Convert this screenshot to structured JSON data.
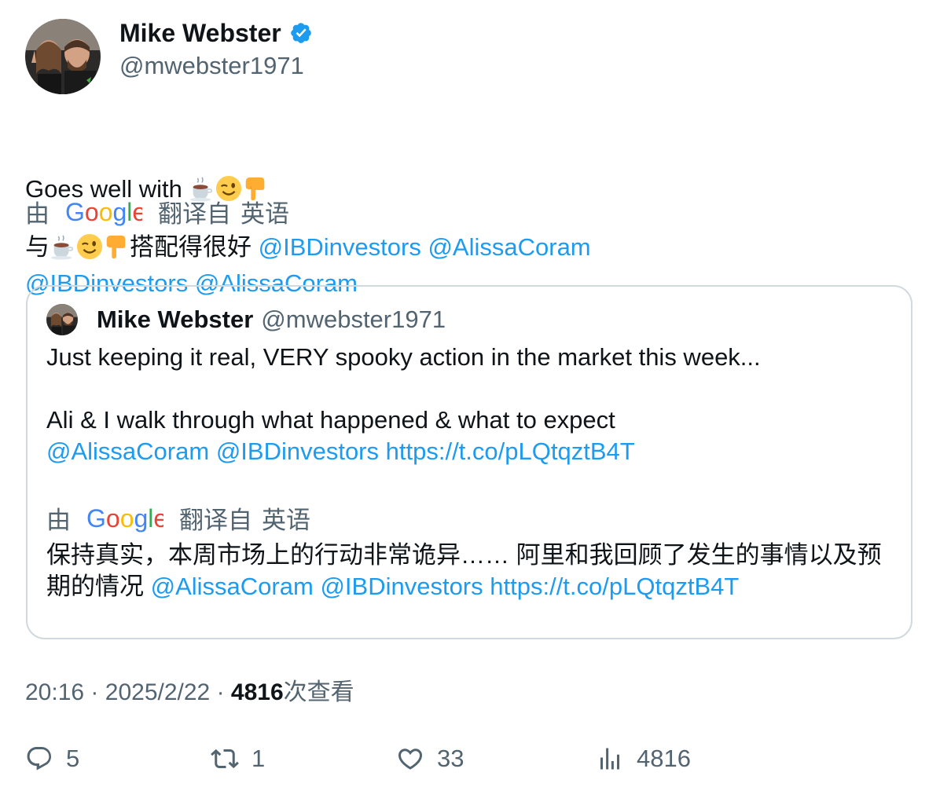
{
  "author": {
    "name": "Mike Webster",
    "handle": "@mwebster1971",
    "verified": true
  },
  "tweet": {
    "text_prefix": "Goes well with ",
    "emojis": [
      "coffee-emoji",
      "wink-emoji",
      "pointing-down-emoji"
    ],
    "mentions": [
      "@IBDinvestors",
      "@AlissaCoram"
    ]
  },
  "translation": {
    "by_label": "由",
    "provider": "Google",
    "from_label": "翻译自",
    "language": "英语",
    "text_prefix": "与",
    "text_suffix": "搭配得很好",
    "mentions": [
      "@IBDinvestors",
      "@AlissaCoram"
    ]
  },
  "quote": {
    "name": "Mike Webster",
    "handle": "@mwebster1971",
    "line1": "Just keeping it real, VERY spooky action in the market this week...",
    "line2": "Ali & I walk through what happened & what to expect",
    "mentions": [
      "@AlissaCoram",
      "@IBDinvestors"
    ],
    "link": "https://t.co/pLQtqztB4T",
    "translation": {
      "by_label": "由",
      "provider": "Google",
      "from_label": "翻译自",
      "language": "英语",
      "text": "保持真实，本周市场上的行动非常诡异…… 阿里和我回顾了发生的事情以及预期的情况",
      "mentions": [
        "@AlissaCoram",
        "@IBDinvestors"
      ],
      "link": "https://t.co/pLQtqztB4T"
    }
  },
  "meta": {
    "time": "20:16",
    "separator": "·",
    "date": "2025/2/22",
    "views_count": "4816",
    "views_label": "次查看"
  },
  "actions": {
    "replies": "5",
    "reposts": "1",
    "likes": "33",
    "views": "4816"
  },
  "colors": {
    "link": "#1d9bf0",
    "secondary": "#536471",
    "verified": "#1d9bf0",
    "border": "#cfd9de"
  }
}
